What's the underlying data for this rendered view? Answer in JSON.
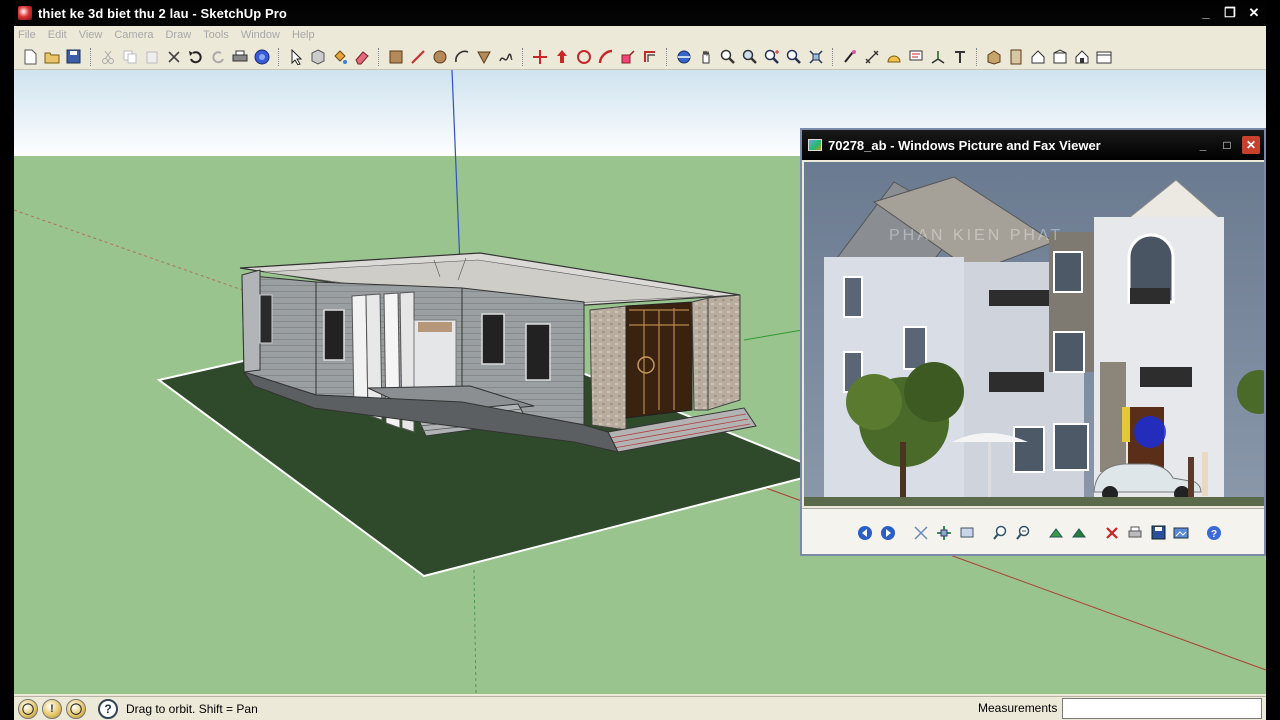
{
  "window": {
    "title": "thiet ke 3d biet thu 2 lau - SketchUp Pro",
    "min_glyph": "_",
    "max_glyph": "❐",
    "close_glyph": "✕"
  },
  "menu": [
    "File",
    "Edit",
    "View",
    "Camera",
    "Draw",
    "Tools",
    "Window",
    "Help"
  ],
  "toolbar": {
    "icons": [
      "new-icon",
      "open-icon",
      "save-icon",
      "cut-icon",
      "copy-icon",
      "paste-icon",
      "erase-icon",
      "undo-icon",
      "redo-icon",
      "print-icon",
      "model-info-icon",
      "select-icon",
      "make-component-icon",
      "paint-bucket-icon",
      "eraser-icon",
      "rectangle-icon",
      "line-icon",
      "circle-icon",
      "arc-icon",
      "polygon-icon",
      "freehand-icon",
      "move-icon",
      "push-pull-icon",
      "rotate-icon",
      "follow-me-icon",
      "scale-icon",
      "offset-icon",
      "orbit-icon",
      "pan-icon",
      "zoom-icon",
      "zoom-window-icon",
      "zoom-extents-icon",
      "previous-view-icon",
      "next-view-icon",
      "tape-measure-icon",
      "dimension-icon",
      "protractor-icon",
      "text-icon",
      "axes-icon",
      "3d-text-icon",
      "iso-view-icon",
      "top-view-icon",
      "front-view-icon",
      "right-view-icon",
      "back-view-icon",
      "left-view-icon"
    ]
  },
  "statusbar": {
    "hint": "Drag to orbit.  Shift = Pan",
    "measurements_label": "Measurements",
    "measurements_value": "",
    "icons": [
      "geo-location-icon",
      "credits-icon",
      "user-icon"
    ],
    "help_glyph": "?",
    "help_icon": "help-icon"
  },
  "viewer": {
    "title": "70278_ab - Windows Picture and Fax Viewer",
    "watermark": "PHAN KIEN PHAT",
    "min_glyph": "_",
    "max_glyph": "□",
    "close_glyph": "✕",
    "toolbar_icons": [
      "previous-image-icon",
      "next-image-icon",
      "best-fit-icon",
      "actual-size-icon",
      "slideshow-icon",
      "zoom-in-icon",
      "zoom-out-icon",
      "rotate-clockwise-icon",
      "rotate-counterclockwise-icon",
      "delete-icon",
      "print-icon",
      "save-icon",
      "edit-icon",
      "help-icon"
    ]
  },
  "colors": {
    "sky_top": "#cfe3ef",
    "sky_bottom": "#fdfeff",
    "ground": "#99c48e",
    "lawn": "#2e4a2a",
    "wall": "#8f9497",
    "roof": "#d8d6d0",
    "titlebar": "#000000"
  }
}
